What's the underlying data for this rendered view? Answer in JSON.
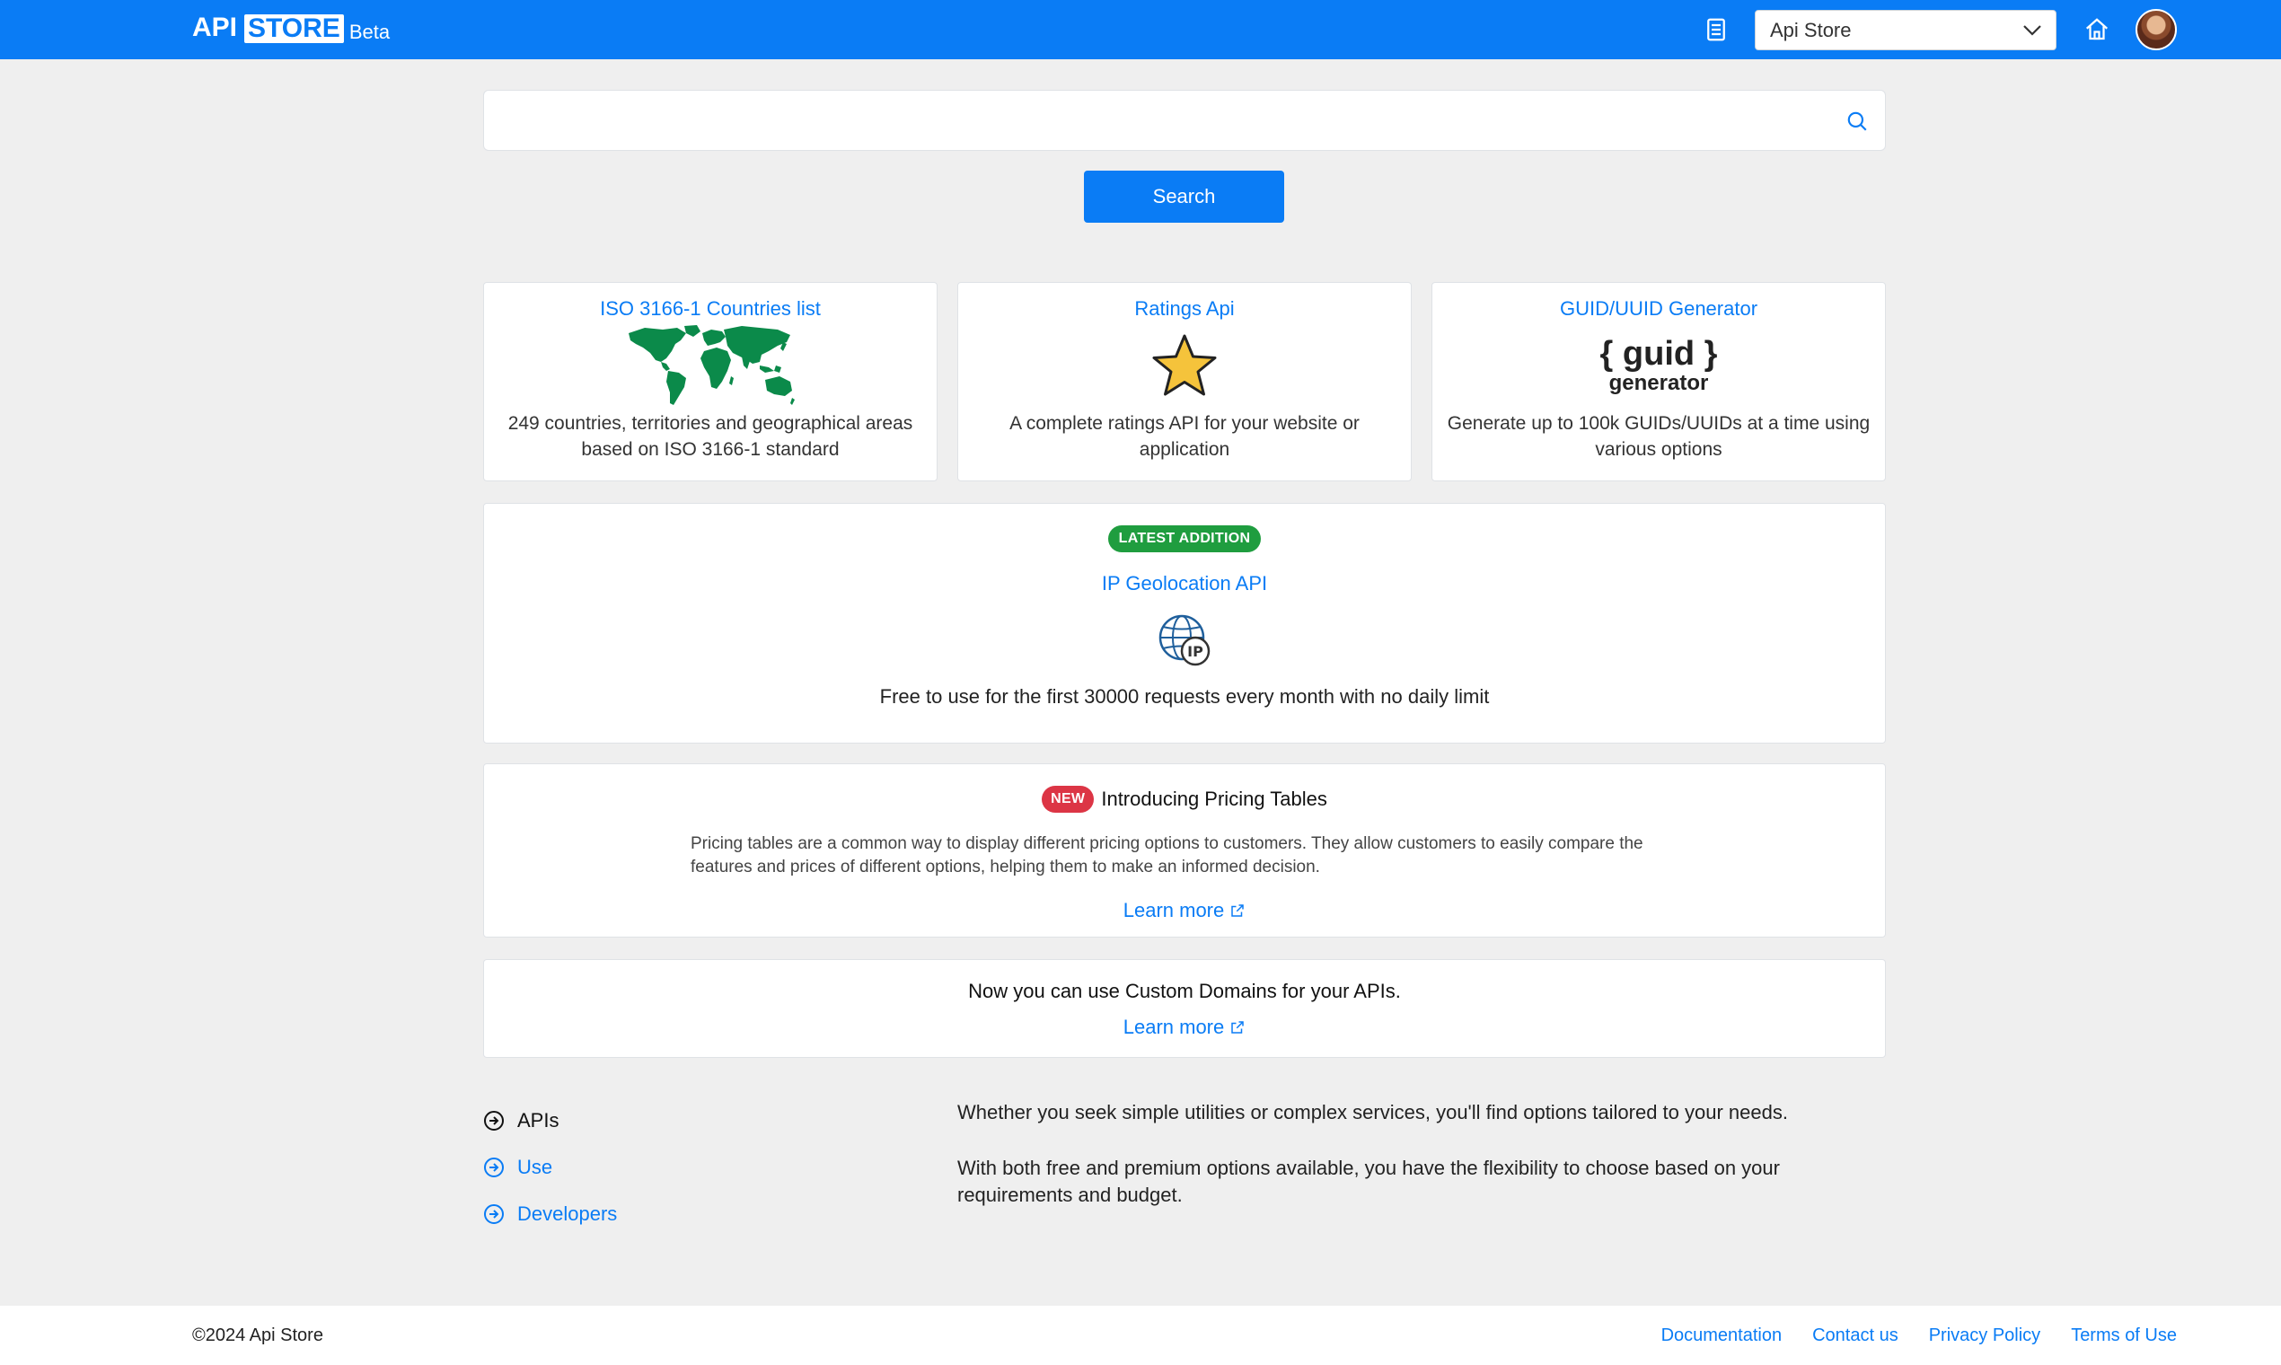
{
  "header": {
    "brand_api": "API",
    "brand_store": "STORE",
    "brand_beta": "Beta",
    "select_value": "Api Store"
  },
  "search": {
    "placeholder": "",
    "button_label": "Search"
  },
  "cards": [
    {
      "title": "ISO 3166-1 Countries list",
      "description": "249 countries, territories and geographical areas based on ISO 3166-1 standard",
      "icon": "world-map-icon"
    },
    {
      "title": "Ratings Api",
      "description": "A complete ratings API for your website or application",
      "icon": "star-icon"
    },
    {
      "title": "GUID/UUID Generator",
      "visual_line1": "{ guid }",
      "visual_line2": "generator",
      "description": "Generate up to 100k GUIDs/UUIDs at a time using various options"
    }
  ],
  "latest": {
    "badge": "LATEST ADDITION",
    "title": "IP Geolocation API",
    "icon": "globe-ip-icon",
    "description": "Free to use for the first 30000 requests every month with no daily limit"
  },
  "pricing": {
    "badge": "NEW",
    "heading": "Introducing Pricing Tables",
    "text": "Pricing tables are a common way to display different pricing options to customers. They allow customers to easily compare the features and prices of different options, helping them to make an informed decision.",
    "learn_more": "Learn more"
  },
  "domains": {
    "heading": "Now you can use Custom Domains for your APIs.",
    "learn_more": "Learn more"
  },
  "links": [
    {
      "label": "APIs"
    },
    {
      "label": "Use"
    },
    {
      "label": "Developers"
    }
  ],
  "info": {
    "p1": "Whether you seek simple utilities or complex services, you'll find options tailored to your needs.",
    "p2": "With both free and premium options available, you have the flexibility to choose based on your requirements and budget."
  },
  "footer": {
    "copyright": "©2024 Api Store",
    "links": [
      "Documentation",
      "Contact us",
      "Privacy Policy",
      "Terms of Use"
    ]
  },
  "colors": {
    "primary": "#0a7cf5",
    "success": "#1f9d3f",
    "danger": "#dc3545",
    "map_green": "#0b8a4a",
    "star_fill": "#f5c33b"
  }
}
